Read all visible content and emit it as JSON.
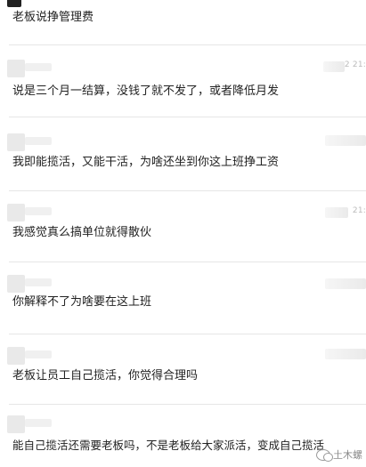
{
  "comments": [
    {
      "text": "老板说挣管理费",
      "time": ""
    },
    {
      "text": "说是三个月一结算，没钱了就不发了，或者降低月发",
      "time": "2 21:"
    },
    {
      "text": "我即能揽活，又能干活，为啥还坐到你这上班挣工资",
      "time": ""
    },
    {
      "text": "我感觉真么搞单位就得散伙",
      "time": "21:"
    },
    {
      "text": "你解释不了为啥要在这上班",
      "time": ""
    },
    {
      "text": "老板让员工自己揽活，你觉得合理吗",
      "time": ""
    },
    {
      "text": "能自己揽活还需要老板吗，不是老板给大家派活，变成自己揽活",
      "time": ""
    }
  ],
  "watermark": {
    "text": "土木螺",
    "icon": "wechat-icon"
  }
}
